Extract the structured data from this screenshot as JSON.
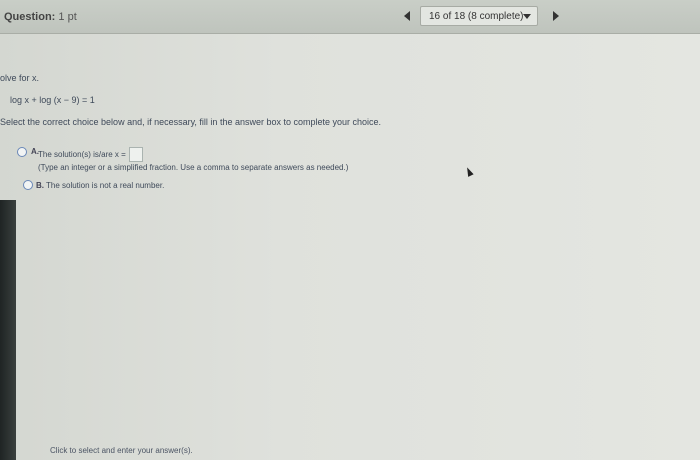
{
  "header": {
    "title": "Question:",
    "points": "1 pt",
    "nav_position": "16 of 18 (8 complete)"
  },
  "question": {
    "instruction": "olve for x.",
    "equation": "log x + log (x − 9) = 1",
    "prompt": "Select the correct choice below and, if necessary, fill in the answer box to complete your choice."
  },
  "options": {
    "a": {
      "letter": "A.",
      "text": "The solution(s) is/are x =",
      "hint": "(Type an integer or a simplified fraction. Use a comma to separate answers as needed.)",
      "answer_value": ""
    },
    "b": {
      "letter": "B.",
      "text": "The solution is not a real number."
    }
  },
  "footer": {
    "text": "Click to select and enter your answer(s)."
  }
}
